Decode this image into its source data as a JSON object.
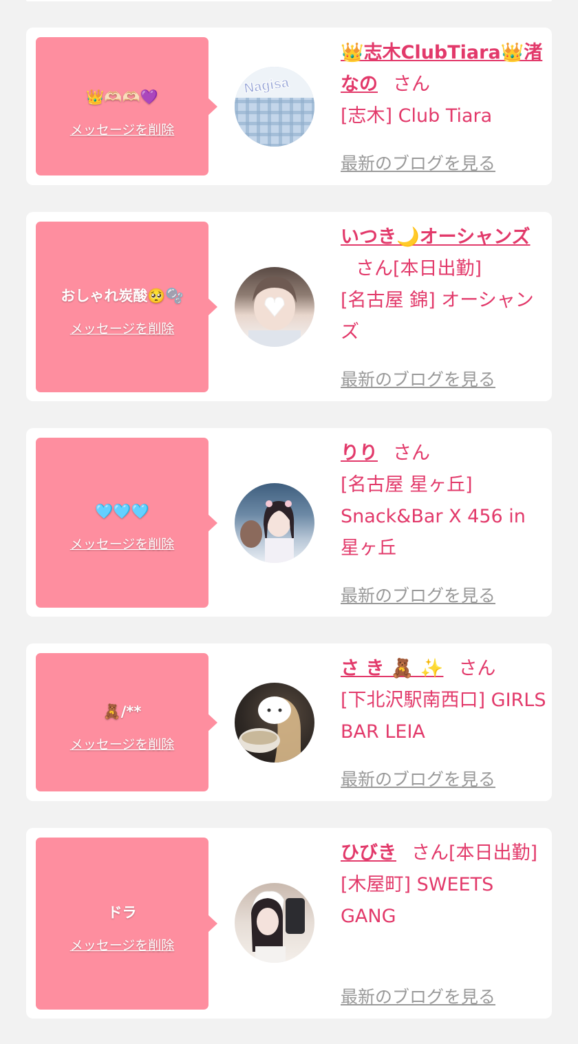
{
  "delete_label": "メッセージを削除",
  "blog_label": "最新のブログを見る",
  "cards": [
    {
      "message": "👑🫶🏻🫶🏻💜",
      "name": "👑志木ClubTiara👑渚なの",
      "san": "さん",
      "status": "",
      "shop": "[志木] Club Tiara",
      "avatar_overlay": "Nagisa"
    },
    {
      "message": "おしゃれ炭酸🥺🫧",
      "name": "いつき🌙オーシャンズ",
      "san": "さん",
      "status": "[本日出勤]",
      "shop": "[名古屋 錦] オーシャンズ",
      "avatar_overlay": ""
    },
    {
      "message": "🩵🩵🩵",
      "name": "りり",
      "san": "さん",
      "status": "",
      "shop": "[名古屋 星ヶ丘] Snack&Bar X 456 in 星ヶ丘",
      "avatar_overlay": ""
    },
    {
      "message": "🧸/**",
      "name": "さ き 🧸 ✨",
      "san": "さん",
      "status": "",
      "shop": "[下北沢駅南西口] GIRLS BAR LEIA",
      "avatar_overlay": ""
    },
    {
      "message": "ドラ",
      "name": "ひびき",
      "san": "さん",
      "status": "[本日出勤]",
      "shop": "[木屋町] SWEETS GANG",
      "avatar_overlay": ""
    }
  ],
  "colors": {
    "page_bg": "#f2f2f2",
    "card_bg": "#ffffff",
    "bubble": "#fe8e9f",
    "accent_pink": "#e2396a",
    "link_gray": "#999999"
  }
}
